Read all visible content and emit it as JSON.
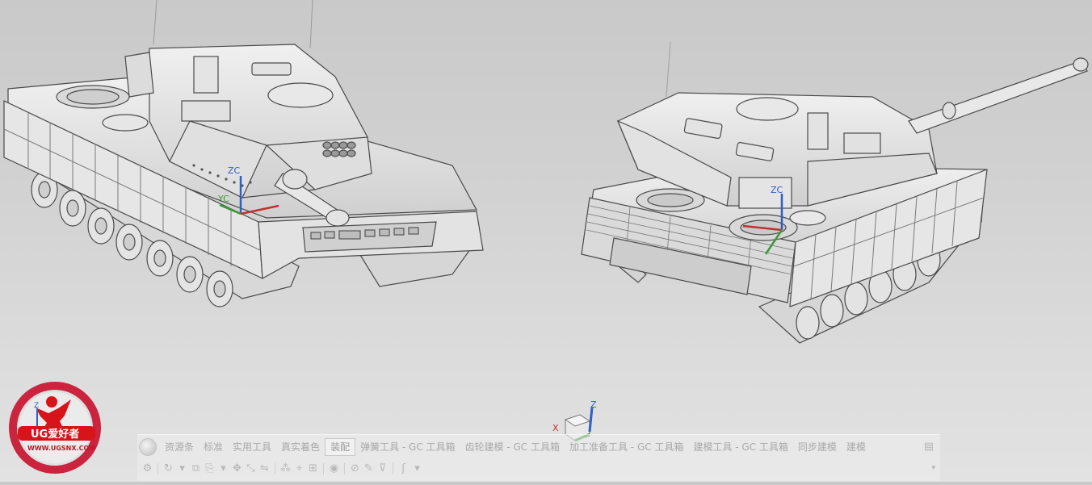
{
  "viewport": {
    "background_top": "#c9c9c9",
    "background_bottom": "#e2e2e2",
    "left_csys": {
      "zc": "ZC",
      "yc": "YC"
    },
    "right_csys": {
      "zc": "ZC"
    },
    "view_triad": {
      "z": "Z",
      "x": "X"
    },
    "watermark": {
      "icon_z": "Z",
      "brand": "UG爱好者",
      "url": "WWW.UGSNX.COM"
    }
  },
  "ribbon": {
    "tabs": [
      {
        "label": "资源条"
      },
      {
        "label": "标准"
      },
      {
        "label": "实用工具"
      },
      {
        "label": "真实着色"
      },
      {
        "label": "装配",
        "active": true
      },
      {
        "label": "弹簧工具 - GC 工具箱"
      },
      {
        "label": "齿轮建模 - GC 工具箱"
      },
      {
        "label": "加工准备工具 - GC 工具箱"
      },
      {
        "label": "建模工具 - GC 工具箱"
      },
      {
        "label": "同步建模"
      },
      {
        "label": "建模"
      }
    ],
    "options_icon": "ribbon-options-icon"
  },
  "toolbar": {
    "items": [
      "settings-icon",
      "rotate-icon",
      "dropdown-icon",
      "copy-icon",
      "paste-icon",
      "dropdown-icon",
      "move-icon",
      "scale-icon",
      "mirror-icon",
      "pattern-icon",
      "snap-icon",
      "constraint-icon",
      "view-icon",
      "measure-icon",
      "wrench-icon",
      "filter-icon",
      "dropdown-icon"
    ]
  }
}
